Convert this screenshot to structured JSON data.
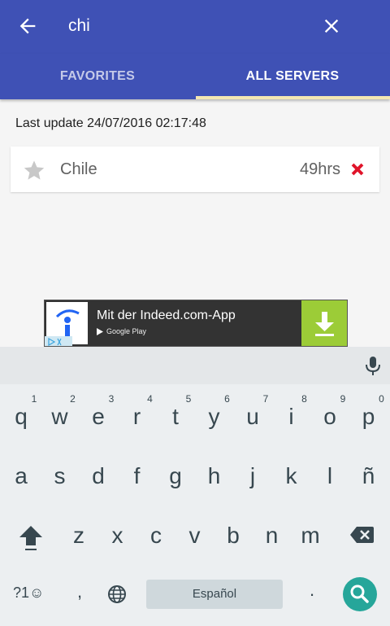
{
  "appbar": {
    "query": "chi"
  },
  "tabs": [
    {
      "label": "FAVORITES"
    },
    {
      "label": "ALL SERVERS"
    }
  ],
  "last_update": "Last update 24/07/2016 02:17:48",
  "servers": [
    {
      "name": "Chile",
      "hours": "49hrs",
      "icon": "star-icon",
      "status_icon": "red-x-icon"
    }
  ],
  "ad": {
    "title": "Mit der Indeed.com-App",
    "store_label": "Google Play"
  },
  "keyboard": {
    "row1": [
      "q",
      "w",
      "e",
      "r",
      "t",
      "y",
      "u",
      "i",
      "o",
      "p"
    ],
    "row1_hints": [
      "1",
      "2",
      "3",
      "4",
      "5",
      "6",
      "7",
      "8",
      "9",
      "0"
    ],
    "row2": [
      "a",
      "s",
      "d",
      "f",
      "g",
      "h",
      "j",
      "k",
      "l",
      "ñ"
    ],
    "row3": [
      "z",
      "x",
      "c",
      "v",
      "b",
      "n",
      "m"
    ],
    "symbols_label": "?1☺",
    "comma": ",",
    "space_label": "Español",
    "period": "."
  },
  "colors": {
    "primary": "#3f51b5",
    "tab_indicator": "#f4e7b2",
    "remove": "#e53935",
    "search_key": "#26a69a",
    "ad_download": "#9ccc37"
  }
}
